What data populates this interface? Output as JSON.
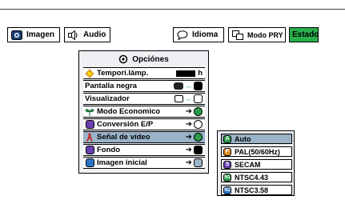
{
  "tabs": [
    {
      "label": "Imagen",
      "icon": "imagen-icon"
    },
    {
      "label": "Audio",
      "icon": "speaker-icon"
    },
    {
      "label": "Idioma",
      "icon": "speech-bubble-icon"
    },
    {
      "label": "Modo PRY",
      "icon": "projector-mode-icon"
    },
    {
      "label": "Estado",
      "active": true
    }
  ],
  "menu": {
    "title": "Opciónes",
    "title_icon": "gear-icon",
    "items": [
      {
        "label": "Temporí.lámp.",
        "icon": "lamp-timer-icon",
        "value": "h"
      },
      {
        "label": "Pantalla negra",
        "icon": "",
        "value": ""
      },
      {
        "label": "Visualizador",
        "icon": "",
        "value": ""
      },
      {
        "label": "Modo Economico",
        "icon": "eco-mode-icon",
        "value": ""
      },
      {
        "label": "Conversión E/P",
        "icon": "conversion-icon",
        "value": ""
      },
      {
        "label": "Señal de vídeo",
        "icon": "video-signal-icon",
        "value": "",
        "selected": true
      },
      {
        "label": "Fondo",
        "icon": "background-icon",
        "value": ""
      },
      {
        "label": "Imagen inicial",
        "icon": "startup-image-icon",
        "value": ""
      }
    ]
  },
  "submenu": {
    "items": [
      {
        "label": "Auto",
        "badge": "A",
        "color": "#2a9d4a",
        "selected": true
      },
      {
        "label": "PAL(50/60Hz)",
        "badge": "P",
        "color": "#e08a1e"
      },
      {
        "label": "SECAM",
        "badge": "S",
        "color": "#6a3fb0"
      },
      {
        "label": "NTSC4.43",
        "badge": "N1",
        "color": "#2a9d4a"
      },
      {
        "label": "NTSC3.58",
        "badge": "N2",
        "color": "#2a72c7"
      }
    ]
  },
  "colors": {
    "accent_green": "#28b04c",
    "selection": "#9ab3c8",
    "menu_bg": "#eef0f3"
  }
}
